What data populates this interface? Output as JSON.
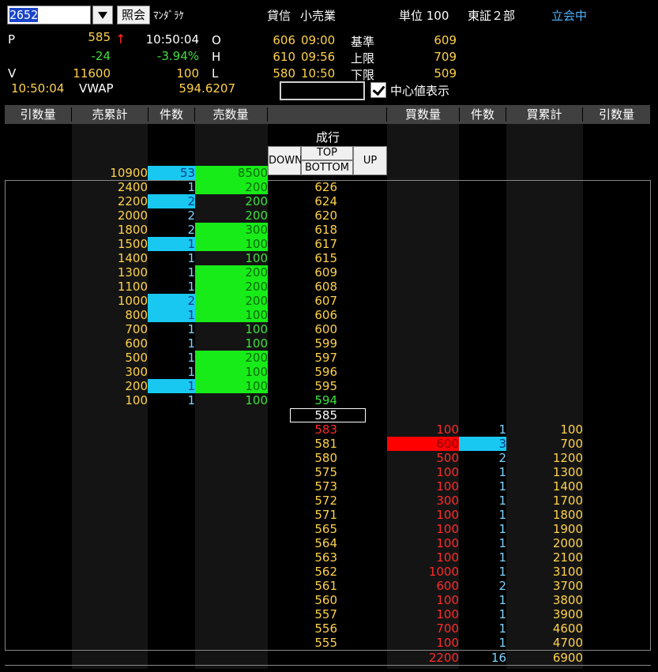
{
  "toolbar": {
    "code": "2652",
    "lookup_label": "照会",
    "name": "ﾏﾝﾀﾞﾗｹ",
    "margin_label": "貸信",
    "industry": "小売業",
    "unit": "単位 100",
    "market": "東証２部",
    "status": "立会中"
  },
  "quote": {
    "p_label": "P",
    "price": "585",
    "arrow": "↑",
    "price_time": "10:50:04",
    "change": "-24",
    "change_pct": "-3.94%",
    "v_label": "V",
    "volume": "11600",
    "trade_qty": "100",
    "vwap_time": "10:50:04",
    "vwap_label": "VWAP",
    "vwap": "594.6207",
    "o_label": "O",
    "open": "606",
    "open_time": "09:00",
    "h_label": "H",
    "high": "610",
    "high_time": "09:56",
    "l_label": "L",
    "low": "580",
    "low_time": "10:50",
    "base_label": "基準",
    "base": "609",
    "upper_label": "上限",
    "upper": "709",
    "lower_label": "下限",
    "lower": "509",
    "center_label": "中心値表示"
  },
  "columns": [
    "引数量",
    "売累計",
    "件数",
    "売数量",
    "",
    "買数量",
    "件数",
    "買累計",
    "引数量"
  ],
  "market_order": {
    "label": "成行",
    "down": "DOWN",
    "top": "TOP",
    "bottom": "BOTTOM",
    "up": "UP",
    "sell_cum": "10900",
    "sell_count": "53",
    "sell_qty": "8500"
  },
  "colors": {
    "cyan": "#19c8f0",
    "green": "#18ec18",
    "red": "#ff0000",
    "yellow": "#ffd24a"
  },
  "asks": [
    {
      "cum": "2400",
      "count": "1",
      "qty": "200",
      "price": "626"
    },
    {
      "cum": "2200",
      "count": "2",
      "qty": "200",
      "price": "624"
    },
    {
      "cum": "2000",
      "count": "2",
      "qty": "200",
      "price": "620"
    },
    {
      "cum": "1800",
      "count": "2",
      "qty": "300",
      "price": "618"
    },
    {
      "cum": "1500",
      "count": "1",
      "qty": "100",
      "price": "617"
    },
    {
      "cum": "1400",
      "count": "1",
      "qty": "100",
      "price": "615"
    },
    {
      "cum": "1300",
      "count": "1",
      "qty": "200",
      "price": "609"
    },
    {
      "cum": "1100",
      "count": "1",
      "qty": "200",
      "price": "608"
    },
    {
      "cum": "1000",
      "count": "2",
      "qty": "200",
      "price": "607"
    },
    {
      "cum": "800",
      "count": "1",
      "qty": "100",
      "price": "606"
    },
    {
      "cum": "700",
      "count": "1",
      "qty": "100",
      "price": "600"
    },
    {
      "cum": "600",
      "count": "1",
      "qty": "100",
      "price": "599"
    },
    {
      "cum": "500",
      "count": "1",
      "qty": "200",
      "price": "597"
    },
    {
      "cum": "300",
      "count": "1",
      "qty": "100",
      "price": "596"
    },
    {
      "cum": "200",
      "count": "1",
      "qty": "100",
      "price": "595"
    },
    {
      "cum": "100",
      "count": "1",
      "qty": "100",
      "price": "594"
    }
  ],
  "current_price": "585",
  "bids": [
    {
      "price": "583",
      "qty": "100",
      "count": "1",
      "cum": "100"
    },
    {
      "price": "581",
      "qty": "600",
      "count": "3",
      "cum": "700"
    },
    {
      "price": "580",
      "qty": "500",
      "count": "2",
      "cum": "1200"
    },
    {
      "price": "575",
      "qty": "100",
      "count": "1",
      "cum": "1300"
    },
    {
      "price": "573",
      "qty": "100",
      "count": "1",
      "cum": "1400"
    },
    {
      "price": "572",
      "qty": "300",
      "count": "1",
      "cum": "1700"
    },
    {
      "price": "571",
      "qty": "100",
      "count": "1",
      "cum": "1800"
    },
    {
      "price": "565",
      "qty": "100",
      "count": "1",
      "cum": "1900"
    },
    {
      "price": "564",
      "qty": "100",
      "count": "1",
      "cum": "2000"
    },
    {
      "price": "563",
      "qty": "100",
      "count": "1",
      "cum": "2100"
    },
    {
      "price": "562",
      "qty": "1000",
      "count": "1",
      "cum": "3100"
    },
    {
      "price": "561",
      "qty": "600",
      "count": "2",
      "cum": "3700"
    },
    {
      "price": "560",
      "qty": "100",
      "count": "1",
      "cum": "3800"
    },
    {
      "price": "557",
      "qty": "100",
      "count": "1",
      "cum": "3900"
    },
    {
      "price": "556",
      "qty": "700",
      "count": "1",
      "cum": "4600"
    },
    {
      "price": "555",
      "qty": "100",
      "count": "1",
      "cum": "4700"
    }
  ],
  "bid_totals": {
    "qty": "2200",
    "count": "16",
    "cum": "6900"
  }
}
